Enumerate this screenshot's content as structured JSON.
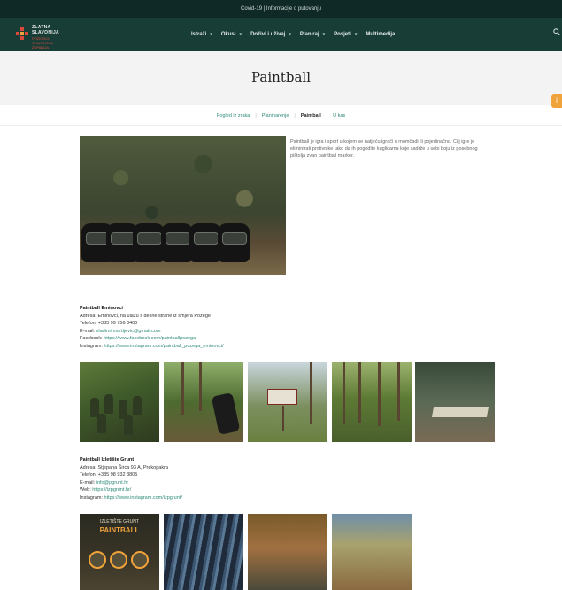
{
  "topbar": {
    "notice": "Covid-19 | Informacije o putovanju"
  },
  "logo": {
    "line1": "ZLATNA",
    "line2": "SLAVONIJA",
    "subline": "POŽEŠKO-SLAVONSKA ŽUPANIJA"
  },
  "nav": {
    "items": [
      {
        "label": "Istraži",
        "has_dropdown": true
      },
      {
        "label": "Okusi",
        "has_dropdown": true
      },
      {
        "label": "Doživi i uživaj",
        "has_dropdown": true
      },
      {
        "label": "Planiraj",
        "has_dropdown": true
      },
      {
        "label": "Posjeti",
        "has_dropdown": true
      },
      {
        "label": "Multimedija",
        "has_dropdown": false
      }
    ],
    "search_icon": "search-icon"
  },
  "hero": {
    "title": "Paintball"
  },
  "side_tab": {
    "icon": "info-icon",
    "glyph": "i"
  },
  "breadcrumbs": [
    {
      "label": "Pogled iz zraka",
      "active": false
    },
    {
      "label": "Planinarenje",
      "active": false
    },
    {
      "label": "Paintball",
      "active": true
    },
    {
      "label": "U kas",
      "active": false
    }
  ],
  "intro": {
    "text": "Paintball je igra i sport u kojem se natjeću igrači u momčadi ili pojedinačno. Cilj igre je eliminirati protivnike tako da ih pogodite kuglicama koje sadrže u sebi boju iz posebnog pištolja zvan paintball marker."
  },
  "clubs": [
    {
      "name": "Paintball Eminovci",
      "address_label": "Adresa:",
      "address": "Eminovci, na ulazu s desne strane iz smjera Požege",
      "phone_label": "Telefon:",
      "phone": "+385 99 756 0400",
      "email_label": "E-mail:",
      "email": "vladimirmartijevic@gmail.com",
      "facebook_label": "Facebook:",
      "facebook": "https://www.facebook.com/paintballpozega",
      "instagram_label": "Instagram:",
      "instagram": "https://www.instagram.com/paintball_pozega_eminovci/"
    },
    {
      "name": "Paintball Izletište Grunt",
      "address_label": "Adresa:",
      "address": "Stjepana Širca 93 A, Prekopakra",
      "phone_label": "Telefon:",
      "phone": "+385 98 932 3805",
      "email_label": "E-mail:",
      "email": "info@pgrunt.hr",
      "web_label": "Web:",
      "web": "https://izpgrunt.hr/",
      "instagram_label": "Instagram:",
      "instagram": "https://www.instagram.com/izpgrunt/"
    }
  ],
  "poster": {
    "top": "IZLETIŠTE GRUNT",
    "title": "PAINTBALL"
  }
}
